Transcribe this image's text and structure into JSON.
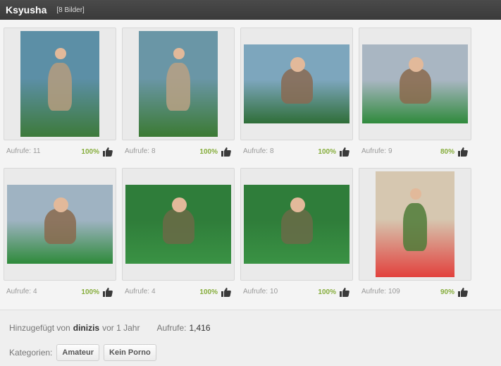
{
  "header": {
    "title": "Ksyusha",
    "image_count": "[8 Bilder]"
  },
  "views_label": "Aufrufe:",
  "gallery": {
    "items": [
      {
        "views": "11",
        "rating": "100%",
        "orientation": "portrait",
        "bg": [
          "#5c8fa6",
          "#3d7a3a"
        ],
        "accent": "#b59c7e"
      },
      {
        "views": "8",
        "rating": "100%",
        "orientation": "portrait",
        "bg": [
          "#6a96a6",
          "#3b7a33"
        ],
        "accent": "#b8a184"
      },
      {
        "views": "8",
        "rating": "100%",
        "orientation": "landscape",
        "bg": [
          "#7da6bd",
          "#2f6e38"
        ],
        "accent": "#8a6a52"
      },
      {
        "views": "9",
        "rating": "80%",
        "orientation": "landscape",
        "bg": [
          "#a9b6c2",
          "#2f8a3c"
        ],
        "accent": "#8b6a4c"
      },
      {
        "views": "4",
        "rating": "100%",
        "orientation": "landscape",
        "bg": [
          "#9fb3c2",
          "#2e8a3a"
        ],
        "accent": "#8a6a4e"
      },
      {
        "views": "4",
        "rating": "100%",
        "orientation": "landscape",
        "bg": [
          "#2f7d3a",
          "#3a9244"
        ],
        "accent": "#6b6a47"
      },
      {
        "views": "10",
        "rating": "100%",
        "orientation": "landscape",
        "bg": [
          "#2f7d3a",
          "#3a9244"
        ],
        "accent": "#6a6b48"
      },
      {
        "views": "109",
        "rating": "90%",
        "orientation": "portrait",
        "bg": [
          "#d6c7b0",
          "#e2413d"
        ],
        "accent": "#4f7b38"
      }
    ]
  },
  "footer": {
    "added_prefix": "Hinzugefügt von",
    "username": "dinizis",
    "added_suffix": "vor 1 Jahr",
    "views_label": "Aufrufe:",
    "views_total": "1,416",
    "categories_label": "Kategorien:",
    "tags": [
      "Amateur",
      "Kein Porno"
    ]
  },
  "colors": {
    "header_bg": "#3f3f3f",
    "rating_green": "#86ad3c",
    "thumb_icon": "#3a3a3a"
  },
  "icons": {
    "rating": "thumbs-up-icon"
  }
}
